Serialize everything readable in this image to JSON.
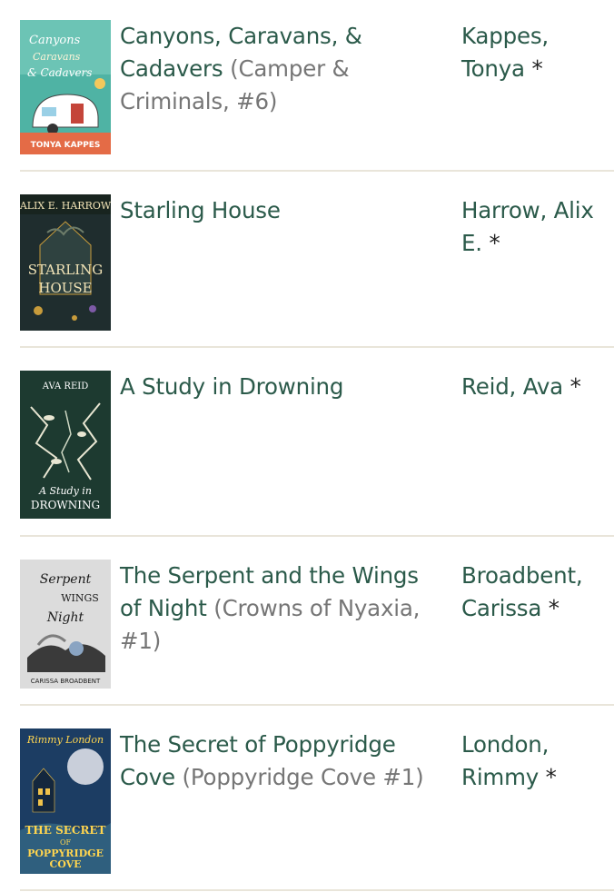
{
  "books": [
    {
      "title": "Canyons, Caravans, & Cadavers",
      "series": "(Camper & Criminals, #6)",
      "author": "Kappes, Tonya",
      "marker": "*",
      "cover_text": "TONYA KAPPES",
      "cover_colors": {
        "bg": "#4fb3a4",
        "accent": "#e46b46",
        "text": "#ffffff"
      }
    },
    {
      "title": "Starling House",
      "series": "",
      "author": "Harrow, Alix E.",
      "marker": "*",
      "cover_text": "ALIX E. HARROW",
      "cover_colors": {
        "bg": "#1f2d2e",
        "accent": "#c79b3b",
        "text": "#f1e3b6"
      }
    },
    {
      "title": "A Study in Drowning",
      "series": "",
      "author": "Reid, Ava",
      "marker": "*",
      "cover_text": "AVA REID",
      "cover_colors": {
        "bg": "#1d3a30",
        "accent": "#e8e6d2",
        "text": "#ffffff"
      }
    },
    {
      "title": "The Serpent and the Wings of Night",
      "series": "(Crowns of Nyaxia, #1)",
      "author": "Broadbent, Carissa",
      "marker": "*",
      "cover_text": "CARISSA BROADBENT",
      "cover_colors": {
        "bg": "#dcdcdc",
        "accent": "#2b2b2b",
        "text": "#1a1a1a"
      }
    },
    {
      "title": "The Secret of Poppyridge Cove",
      "series": "(Poppyridge Cove #1)",
      "author": "London, Rimmy",
      "marker": "*",
      "cover_text": "Rimmy London",
      "cover_colors": {
        "bg": "#1c3d63",
        "accent": "#f0c24a",
        "text": "#ffd54f"
      }
    }
  ]
}
